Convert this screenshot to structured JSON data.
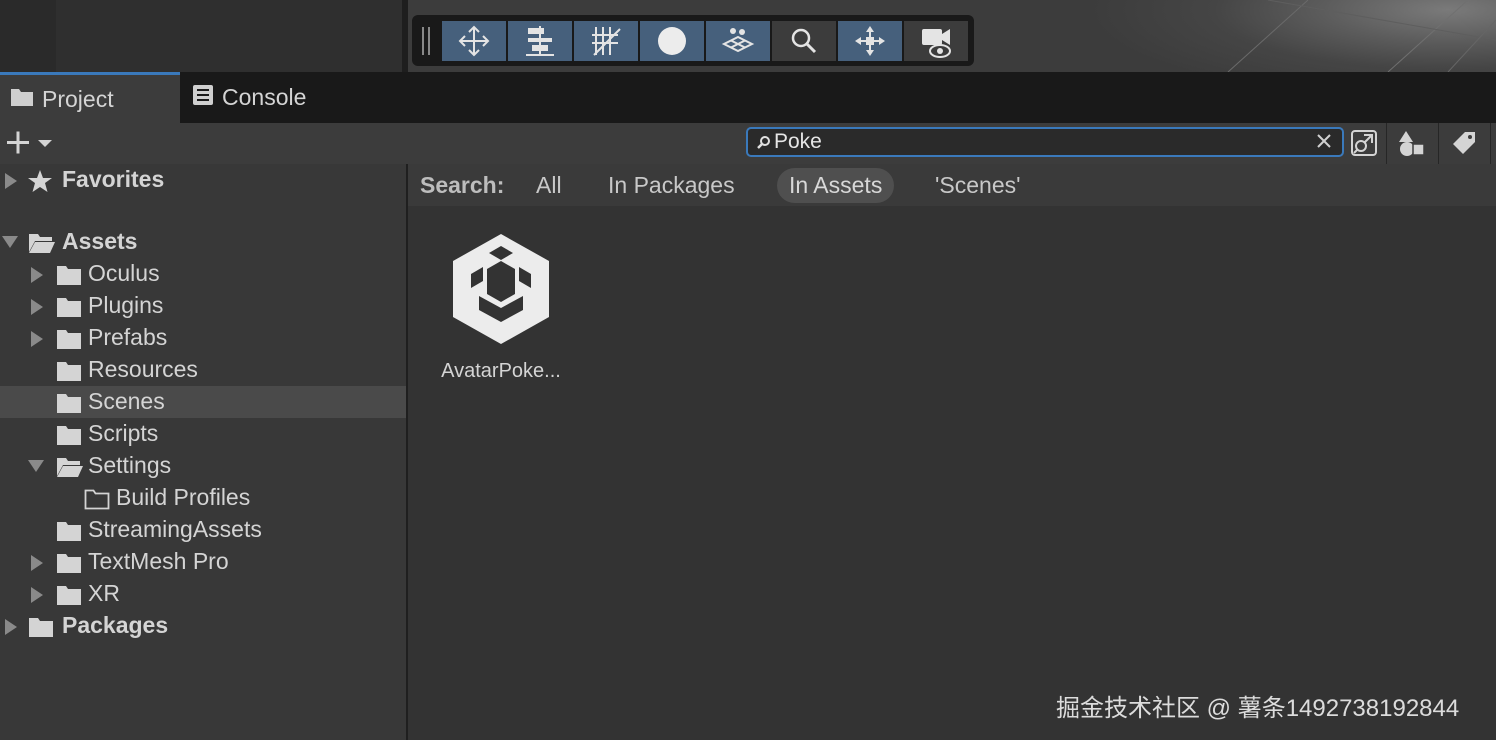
{
  "scene_toolbar": {
    "tools": [
      {
        "name": "move-tool",
        "icon": "move-arrows-icon",
        "active": true
      },
      {
        "name": "align-tool",
        "icon": "align-icon",
        "active": true
      },
      {
        "name": "grid-snap-tool",
        "icon": "grid-snap-icon",
        "active": true
      },
      {
        "name": "shading-tool",
        "icon": "circle-icon",
        "active": true
      },
      {
        "name": "layers-tool",
        "icon": "layers-icon",
        "active": true
      },
      {
        "name": "search-tool",
        "icon": "magnifier-icon",
        "active": false
      },
      {
        "name": "pivot-tool",
        "icon": "pivot-icon",
        "active": true
      },
      {
        "name": "camera-tool",
        "icon": "camera-eye-icon",
        "active": false
      }
    ]
  },
  "tabs": [
    {
      "label": "Project",
      "icon": "folder-icon",
      "active": true
    },
    {
      "label": "Console",
      "icon": "console-icon",
      "active": false
    }
  ],
  "toolbar": {
    "create_icon": "plus-dropdown-icon",
    "search_value": "Poke",
    "search_icon": "search-icon",
    "clear_icon": "close-icon",
    "buttons": [
      "open-in-window-icon",
      "filter-by-type-icon",
      "filter-by-label-icon"
    ]
  },
  "tree": {
    "favorites": "Favorites",
    "assets": "Assets",
    "assets_children": [
      "Oculus",
      "Plugins",
      "Prefabs",
      "Resources",
      "Scenes",
      "Scripts",
      "Settings",
      "StreamingAssets",
      "TextMesh Pro",
      "XR"
    ],
    "settings_children": [
      "Build Profiles"
    ],
    "packages": "Packages",
    "selected": "Scenes"
  },
  "search_scope": {
    "label": "Search:",
    "options": [
      "All",
      "In Packages",
      "In Assets",
      "'Scenes'"
    ],
    "selected": "In Assets"
  },
  "results": [
    {
      "name": "AvatarPoke...",
      "icon": "unity-scene-icon"
    }
  ],
  "watermark": "掘金技术社区 @ 薯条1492738192844",
  "colors": {
    "accent": "#3a79bb",
    "active_tool": "#46607c",
    "panel": "#383838",
    "content": "#333333"
  }
}
